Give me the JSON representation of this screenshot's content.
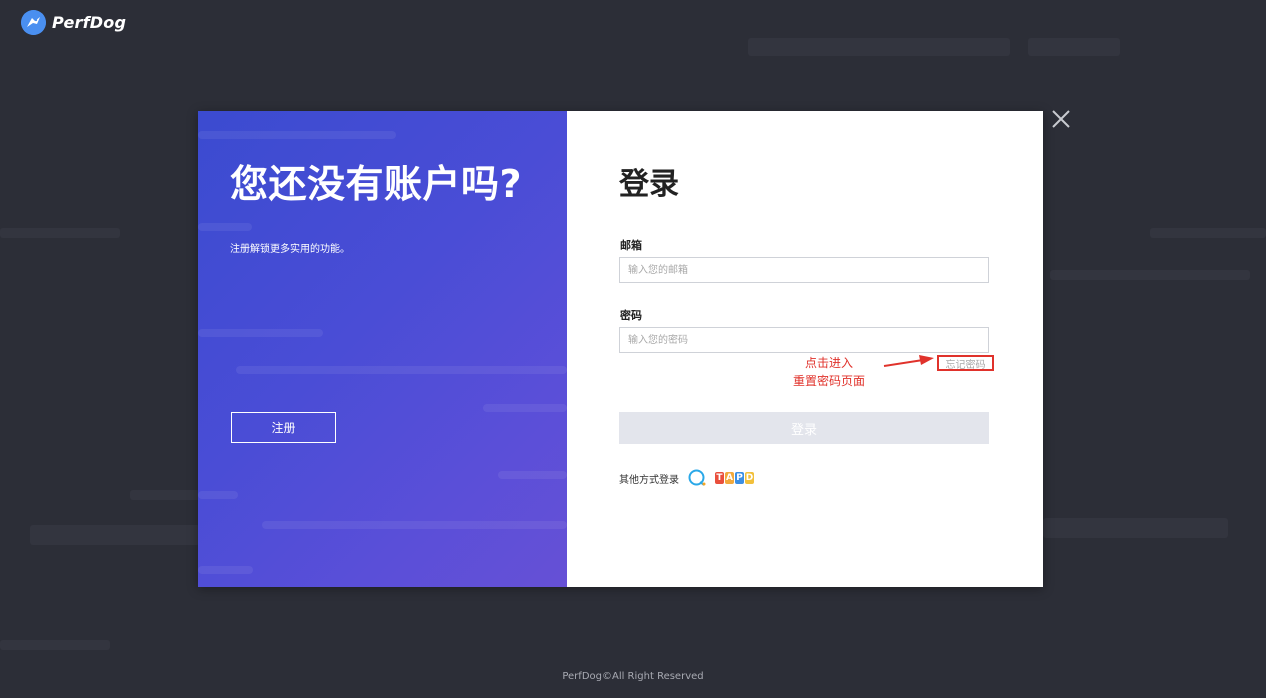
{
  "header": {
    "logo_text": "PerfDog"
  },
  "promo": {
    "title": "您还没有账户吗?",
    "subtitle": "注册解锁更多实用的功能。",
    "register_label": "注册"
  },
  "login": {
    "title": "登录",
    "email_label": "邮箱",
    "email_placeholder": "输入您的邮箱",
    "email_value": "",
    "password_label": "密码",
    "password_placeholder": "输入您的密码",
    "password_value": "",
    "forgot_label": "忘记密码",
    "submit_label": "登录",
    "other_methods_label": "其他方式登录",
    "other_methods": [
      "qq-icon",
      "tapd-icon"
    ],
    "tapd_letters": [
      "T",
      "A",
      "P",
      "D"
    ]
  },
  "annotation": {
    "line1": "点击进入",
    "line2": "重置密码页面"
  },
  "footer": {
    "text": "PerfDog©All Right Reserved"
  },
  "colors": {
    "page_bg": "#2c2e37",
    "promo_gradient_start": "#3b4bd0",
    "promo_gradient_end": "#6650d6",
    "annotation_red": "#e0322b",
    "disabled_button": "#e3e5ec",
    "logo_blue": "#4a8ff0"
  }
}
